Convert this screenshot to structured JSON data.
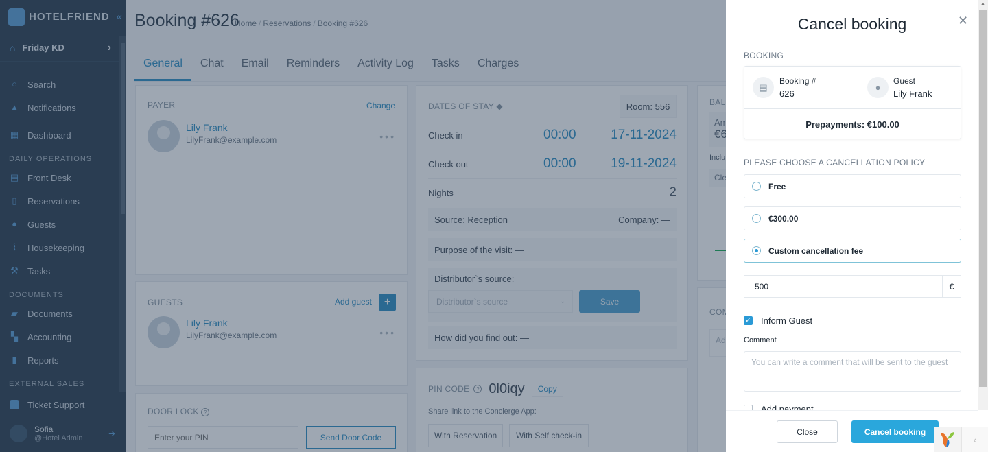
{
  "sidebar": {
    "brand": "HOTELFRIEND",
    "hotel": "Friday KD",
    "top_items": [
      {
        "label": "Search",
        "icon": "search-icon"
      },
      {
        "label": "Notifications",
        "icon": "bell-icon"
      },
      {
        "label": "Dashboard",
        "icon": "dashboard-icon"
      }
    ],
    "sections": [
      {
        "title": "DAILY OPERATIONS",
        "items": [
          {
            "label": "Front Desk",
            "icon": "calendar-icon"
          },
          {
            "label": "Reservations",
            "icon": "document-icon"
          },
          {
            "label": "Guests",
            "icon": "person-icon"
          },
          {
            "label": "Housekeeping",
            "icon": "broom-icon"
          },
          {
            "label": "Tasks",
            "icon": "wrench-icon"
          }
        ]
      },
      {
        "title": "DOCUMENTS",
        "items": [
          {
            "label": "Documents",
            "icon": "folder-icon"
          },
          {
            "label": "Accounting",
            "icon": "accounting-icon"
          },
          {
            "label": "Reports",
            "icon": "clipboard-icon"
          }
        ]
      },
      {
        "title": "EXTERNAL SALES",
        "items": []
      }
    ],
    "ticket_support": "Ticket Support",
    "user": {
      "name": "Sofia",
      "role": "@Hotel Admin"
    }
  },
  "header": {
    "title": "Booking #626",
    "breadcrumb": [
      "Home",
      "Reservations",
      "Booking #626"
    ]
  },
  "tabs": [
    "General",
    "Chat",
    "Email",
    "Reminders",
    "Activity Log",
    "Tasks",
    "Charges"
  ],
  "payer": {
    "label": "PAYER",
    "change": "Change",
    "name": "Lily Frank",
    "email": "LilyFrank@example.com"
  },
  "guests": {
    "label": "GUESTS",
    "add": "Add guest",
    "name": "Lily Frank",
    "email": "LilyFrank@example.com"
  },
  "door_lock": {
    "label": "DOOR LOCK",
    "placeholder": "Enter your PIN",
    "send": "Send Door Code"
  },
  "stay": {
    "label": "DATES OF STAY",
    "room": "Room: 556",
    "check_in_label": "Check in",
    "check_in_time": "00:00",
    "check_in_date": "17-11-2024",
    "check_out_label": "Check out",
    "check_out_time": "00:00",
    "check_out_date": "19-11-2024",
    "nights_label": "Nights",
    "nights": "2",
    "source": "Source: Reception",
    "company": "Company: —",
    "purpose": "Purpose of the visit: —",
    "distributor_label": "Distributor`s source:",
    "distributor_placeholder": "Distributor`s source",
    "save": "Save",
    "found_out": "How did you find out: —"
  },
  "pin": {
    "label": "PIN CODE",
    "code": "0l0iqy",
    "copy": "Copy",
    "share": "Share link to the Concierge App:",
    "with_reservation": "With Reservation",
    "with_self_checkin": "With Self check-in"
  },
  "balance_partial": {
    "label": "BAL",
    "amount_label": "Am",
    "amount": "€6",
    "incl": "Inclu",
    "cle": "Cle",
    "comments_label": "COM",
    "comments_placeholder": "Ad"
  },
  "modal": {
    "title": "Cancel booking",
    "booking_section": "BOOKING",
    "booking_label": "Booking #",
    "booking_value": "626",
    "guest_label": "Guest",
    "guest_value": "Lily Frank",
    "prepayments": "Prepayments: €100.00",
    "policy_section": "PLEASE CHOOSE A CANCELLATION POLICY",
    "options": [
      {
        "label": "Free",
        "selected": false
      },
      {
        "label": "€300.00",
        "selected": false
      },
      {
        "label": "Custom cancellation fee",
        "selected": true
      }
    ],
    "fee_value": "500",
    "currency": "€",
    "inform_guest": "Inform Guest",
    "inform_guest_checked": true,
    "comment_label": "Comment",
    "comment_placeholder": "You can write a comment that will be sent to the guest",
    "add_payment": "Add payment",
    "add_payment_checked": false,
    "close": "Close",
    "cancel": "Cancel booking"
  }
}
